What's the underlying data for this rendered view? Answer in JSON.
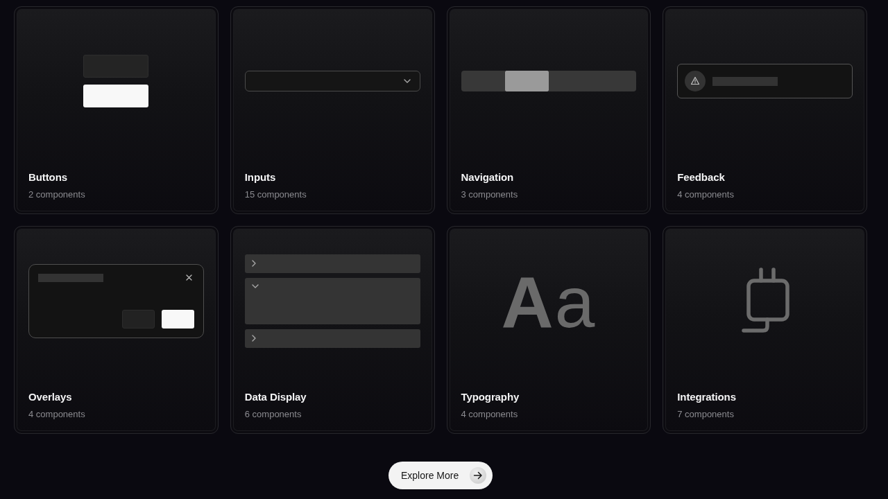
{
  "categories": [
    {
      "title": "Buttons",
      "count": "2 components",
      "preview": {
        "kind": "buttons"
      }
    },
    {
      "title": "Inputs",
      "count": "15 components",
      "preview": {
        "kind": "select"
      }
    },
    {
      "title": "Navigation",
      "count": "3 components",
      "preview": {
        "kind": "tabs",
        "segments": [
          {
            "selected": false
          },
          {
            "selected": true
          },
          {
            "selected": false
          },
          {
            "selected": false
          }
        ]
      }
    },
    {
      "title": "Feedback",
      "count": "4 components",
      "preview": {
        "kind": "alert"
      }
    },
    {
      "title": "Overlays",
      "count": "4 components",
      "preview": {
        "kind": "dialog"
      }
    },
    {
      "title": "Data Display",
      "count": "6 components",
      "preview": {
        "kind": "accordion",
        "items": [
          {
            "expanded": false
          },
          {
            "expanded": true
          },
          {
            "expanded": false
          }
        ]
      }
    },
    {
      "title": "Typography",
      "count": "4 components",
      "preview": {
        "kind": "type",
        "sample": "**A**a"
      }
    },
    {
      "title": "Integrations",
      "count": "7 components",
      "preview": {
        "kind": "plug"
      }
    }
  ],
  "explore_button": {
    "label": "Explore More"
  }
}
